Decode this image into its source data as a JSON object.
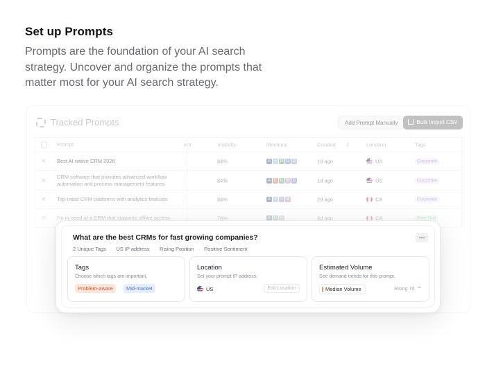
{
  "intro": {
    "title": "Set up Prompts",
    "description": "Prompts are the foundation of your AI search strategy. Uncover and organize the prompts that matter most for your AI search strategy."
  },
  "tracked": {
    "title": "Tracked Prompts",
    "add_manual_label": "Add Prompt Manually",
    "bulk_import_label": "Bulk Import CSV",
    "columns": [
      "Prompt",
      "ent",
      "Visibility",
      "Mentions",
      "Created",
      "Location",
      "Tags"
    ],
    "rows": [
      {
        "prompt": "Best AI native CRM 2026",
        "visibility": "84%",
        "created": "1d ago",
        "location": "US",
        "tag": "Corporate"
      },
      {
        "prompt": "CRM software that provides advanced workflow automation and process management features",
        "visibility": "84%",
        "created": "1d ago",
        "location": "US",
        "tag": "Corporate"
      },
      {
        "prompt": "Top-rated CRM platforms with analytics features",
        "visibility": "84%",
        "created": "2d ago",
        "location": "CA",
        "tag": "Corporate"
      },
      {
        "prompt": "I'm in need of a CRM that supports offline access",
        "visibility": "78%",
        "created": "4d ago",
        "location": "CA",
        "tag": "Free Trial"
      }
    ]
  },
  "popup": {
    "question": "What are the best CRMs for fast growing companies?",
    "meta": [
      "2 Unique Tags",
      "US IP address",
      "Rising Position",
      "Positive Sentiment"
    ],
    "tags_panel": {
      "title": "Tags",
      "subtitle": "Choose which tags are important.",
      "chips": [
        "Problem-aware",
        "Mid-market"
      ]
    },
    "location_panel": {
      "title": "Location",
      "subtitle": "Set your prompt IP address.",
      "value": "US",
      "edit_label": "Edit Location"
    },
    "volume_panel": {
      "title": "Estimated Volume",
      "subtitle": "See demand trends for this prompt.",
      "value": "Median Volume",
      "trend": "Rising 7d"
    }
  },
  "colors": {
    "accent_orange": "#cc5a2f",
    "accent_blue": "#4a77c9",
    "trend_green": "#5fb37b"
  }
}
